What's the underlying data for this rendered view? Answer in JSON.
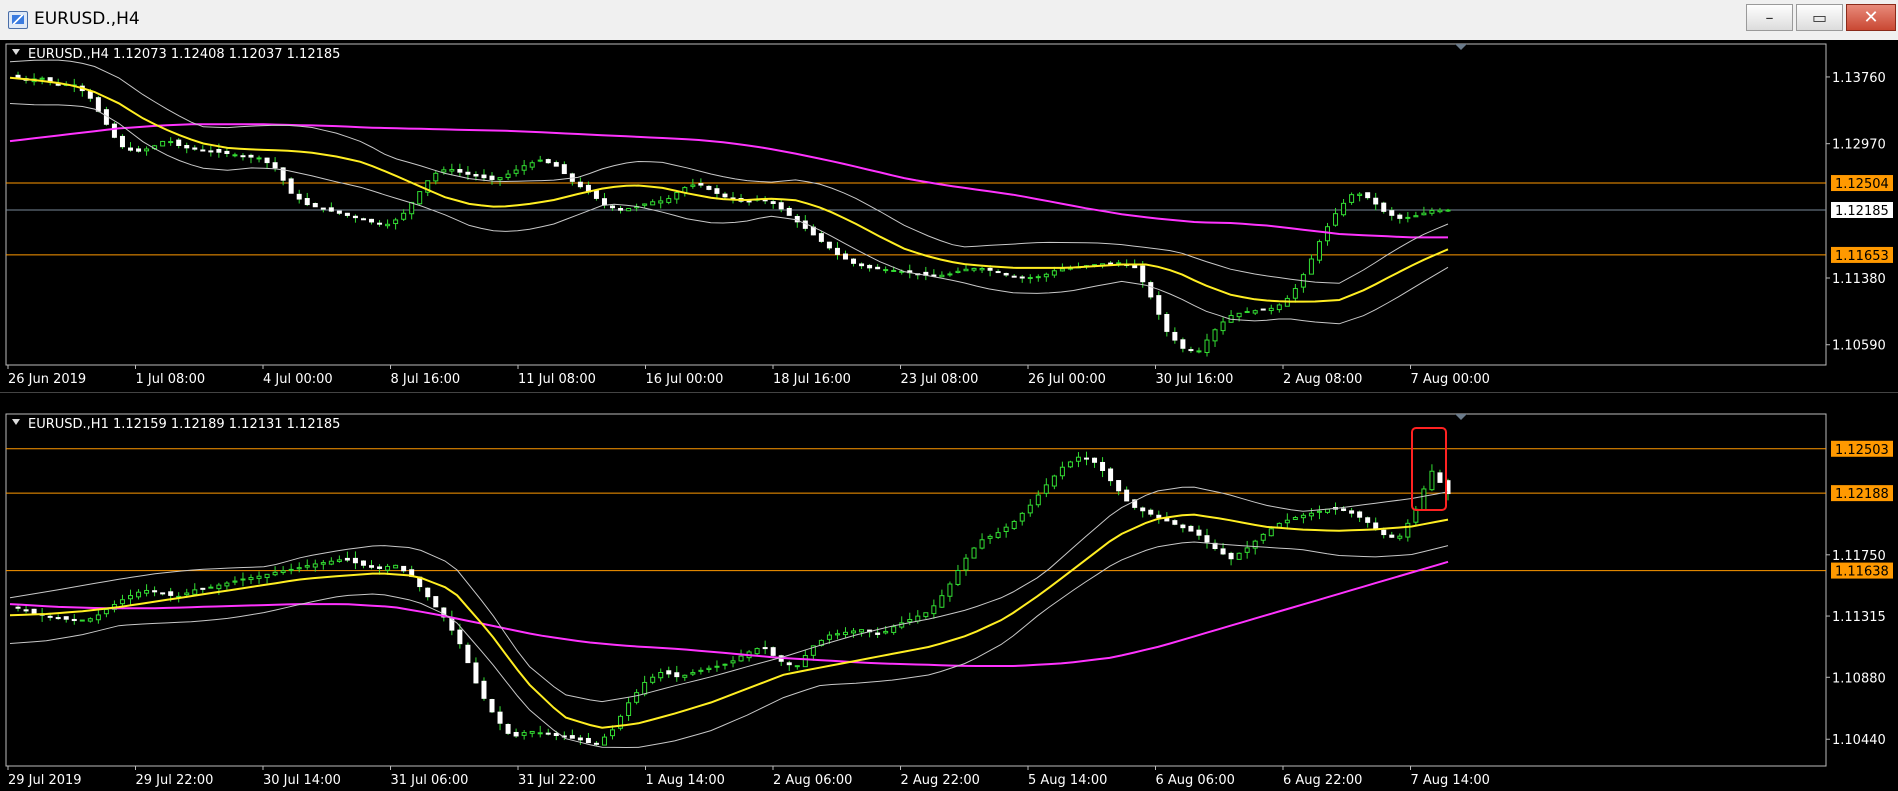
{
  "window": {
    "title": "EURUSD.,H4",
    "buttons": {
      "minimize": "–",
      "maximize": "▭",
      "close": "✕"
    }
  },
  "chart_data": [
    {
      "type": "candlestick",
      "symbol": "EURUSD.",
      "timeframe": "H4",
      "info_text": "EURUSD.,H4  1.12073 1.12408 1.12037 1.12185",
      "ohlc": {
        "open": 1.12073,
        "high": 1.12408,
        "low": 1.12037,
        "close": 1.12185
      },
      "y_ticks": [
        "1.13760",
        "1.12970",
        "1.11380",
        "1.10590"
      ],
      "x_ticks": [
        "26 Jun 2019",
        "1 Jul 08:00",
        "4 Jul 00:00",
        "8 Jul 16:00",
        "11 Jul 08:00",
        "16 Jul 00:00",
        "18 Jul 16:00",
        "23 Jul 08:00",
        "26 Jul 00:00",
        "30 Jul 16:00",
        "2 Aug 08:00",
        "7 Aug 00:00"
      ],
      "ylim": [
        1.1035,
        1.1415
      ],
      "horizontal_lines": [
        {
          "price": 1.12504,
          "label": "1.12504",
          "color": "#ff9900"
        },
        {
          "price": 1.11653,
          "label": "1.11653",
          "color": "#ff9900"
        }
      ],
      "current_price": {
        "price": 1.12185,
        "label": "1.12185"
      },
      "close_path": [
        1.1378,
        1.1372,
        1.1375,
        1.1366,
        1.1368,
        1.1355,
        1.1325,
        1.1295,
        1.1287,
        1.1292,
        1.1302,
        1.1293,
        1.129,
        1.1288,
        1.1285,
        1.1282,
        1.128,
        1.1268,
        1.1238,
        1.1225,
        1.122,
        1.1215,
        1.121,
        1.1205,
        1.12,
        1.121,
        1.1235,
        1.126,
        1.1268,
        1.1262,
        1.1258,
        1.1254,
        1.1262,
        1.1272,
        1.1278,
        1.127,
        1.1252,
        1.124,
        1.1225,
        1.1218,
        1.1222,
        1.1228,
        1.123,
        1.1244,
        1.125,
        1.124,
        1.1232,
        1.1228,
        1.1232,
        1.1225,
        1.121,
        1.1195,
        1.118,
        1.1165,
        1.1155,
        1.115,
        1.1148,
        1.1146,
        1.1143,
        1.114,
        1.1142,
        1.1148,
        1.115,
        1.1146,
        1.114,
        1.1138,
        1.114,
        1.1148,
        1.115,
        1.1153,
        1.1155,
        1.1156,
        1.115,
        1.1115,
        1.1075,
        1.1055,
        1.105,
        1.1075,
        1.1093,
        1.1098,
        1.11,
        1.1103,
        1.1118,
        1.115,
        1.119,
        1.122,
        1.124,
        1.1232,
        1.1215,
        1.1208,
        1.1212,
        1.1218,
        1.12185
      ],
      "ma_yellow": [
        1.1375,
        1.1372,
        1.1368,
        1.136,
        1.1345,
        1.1325,
        1.131,
        1.1298,
        1.1292,
        1.129,
        1.1289,
        1.1287,
        1.1282,
        1.1275,
        1.1262,
        1.1248,
        1.1234,
        1.1225,
        1.1222,
        1.1225,
        1.123,
        1.1238,
        1.1245,
        1.1248,
        1.1245,
        1.1238,
        1.1232,
        1.123,
        1.1232,
        1.123,
        1.122,
        1.1205,
        1.1188,
        1.1172,
        1.1162,
        1.1155,
        1.1152,
        1.115,
        1.115,
        1.115,
        1.1152,
        1.1154,
        1.1154,
        1.1145,
        1.113,
        1.1118,
        1.1112,
        1.111,
        1.111,
        1.1112,
        1.1125,
        1.1142,
        1.1158,
        1.1172
      ],
      "ma_magenta": [
        1.13,
        1.1305,
        1.131,
        1.1315,
        1.1318,
        1.132,
        1.132,
        1.132,
        1.1319,
        1.1318,
        1.1316,
        1.1315,
        1.1314,
        1.1313,
        1.1312,
        1.131,
        1.1308,
        1.1306,
        1.1304,
        1.1302,
        1.1298,
        1.1292,
        1.1284,
        1.1275,
        1.1265,
        1.1255,
        1.1248,
        1.1242,
        1.1236,
        1.1228,
        1.122,
        1.1213,
        1.1208,
        1.1204,
        1.1203,
        1.12,
        1.1195,
        1.119,
        1.1188,
        1.1186,
        1.1186
      ]
    },
    {
      "type": "candlestick",
      "symbol": "EURUSD.",
      "timeframe": "H1",
      "info_text": "EURUSD.,H1  1.12159 1.12189 1.12131 1.12185",
      "ohlc": {
        "open": 1.12159,
        "high": 1.12189,
        "low": 1.12131,
        "close": 1.12185
      },
      "y_ticks": [
        "1.11750",
        "1.11315",
        "1.10880",
        "1.10440"
      ],
      "x_ticks": [
        "29 Jul 2019",
        "29 Jul 22:00",
        "30 Jul 14:00",
        "31 Jul 06:00",
        "31 Jul 22:00",
        "1 Aug 14:00",
        "2 Aug 06:00",
        "2 Aug 22:00",
        "5 Aug 14:00",
        "6 Aug 06:00",
        "6 Aug 22:00",
        "7 Aug 14:00"
      ],
      "ylim": [
        1.1025,
        1.1275
      ],
      "horizontal_lines": [
        {
          "price": 1.12503,
          "label": "1.12503",
          "color": "#ff9900"
        },
        {
          "price": 1.12188,
          "label": "1.12188",
          "color": "#ff9900"
        },
        {
          "price": 1.11638,
          "label": "1.11638",
          "color": "#ff9900"
        }
      ],
      "close_path": [
        1.1139,
        1.1135,
        1.1132,
        1.113,
        1.1128,
        1.113,
        1.1138,
        1.1145,
        1.115,
        1.1148,
        1.1145,
        1.115,
        1.1152,
        1.1155,
        1.1158,
        1.116,
        1.1163,
        1.1165,
        1.1168,
        1.117,
        1.1172,
        1.1168,
        1.1165,
        1.1168,
        1.116,
        1.1145,
        1.113,
        1.111,
        1.108,
        1.106,
        1.1045,
        1.105,
        1.1048,
        1.1046,
        1.1044,
        1.104,
        1.105,
        1.107,
        1.1085,
        1.1092,
        1.1088,
        1.1092,
        1.1095,
        1.1098,
        1.1105,
        1.111,
        1.11,
        1.1095,
        1.111,
        1.1118,
        1.112,
        1.1122,
        1.1118,
        1.1125,
        1.113,
        1.1135,
        1.115,
        1.117,
        1.1185,
        1.119,
        1.1198,
        1.121,
        1.1225,
        1.1238,
        1.1245,
        1.124,
        1.1225,
        1.121,
        1.1205,
        1.12,
        1.1195,
        1.119,
        1.118,
        1.1172,
        1.118,
        1.119,
        1.1198,
        1.1202,
        1.1205,
        1.1208,
        1.1206,
        1.12,
        1.119,
        1.1186,
        1.1205,
        1.1235,
        1.12185
      ],
      "ma_yellow": [
        1.1132,
        1.1133,
        1.1135,
        1.1138,
        1.1142,
        1.1146,
        1.115,
        1.1154,
        1.1158,
        1.116,
        1.1162,
        1.116,
        1.115,
        1.112,
        1.1085,
        1.106,
        1.1052,
        1.1055,
        1.1062,
        1.107,
        1.108,
        1.109,
        1.1095,
        1.11,
        1.1105,
        1.111,
        1.1118,
        1.113,
        1.1148,
        1.1168,
        1.1188,
        1.12,
        1.1204,
        1.12,
        1.1195,
        1.1193,
        1.1192,
        1.1193,
        1.1195,
        1.12
      ],
      "ma_magenta": [
        1.114,
        1.1138,
        1.1137,
        1.1137,
        1.1138,
        1.1139,
        1.114,
        1.114,
        1.1138,
        1.1132,
        1.1125,
        1.1118,
        1.1113,
        1.111,
        1.1108,
        1.1105,
        1.1102,
        1.11,
        1.1098,
        1.1097,
        1.1096,
        1.1096,
        1.1098,
        1.1102,
        1.111,
        1.112,
        1.113,
        1.114,
        1.115,
        1.116,
        1.117
      ]
    }
  ]
}
